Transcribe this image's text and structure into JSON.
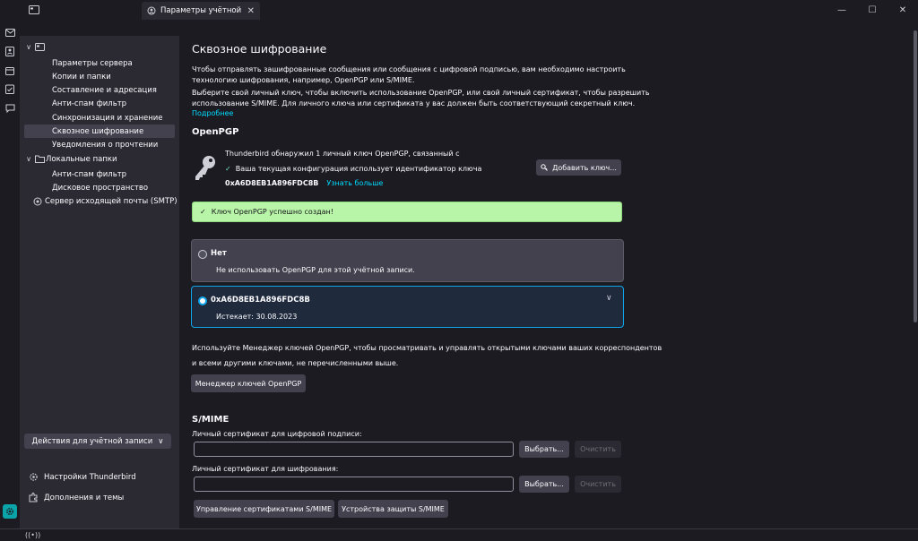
{
  "window": {
    "tab_title": "Параметры учётной записи",
    "minimize": "—",
    "maximize": "☐",
    "close": "✕"
  },
  "sidebar": {
    "account_row_label": "",
    "items": [
      {
        "label": "Параметры сервера"
      },
      {
        "label": "Копии и папки"
      },
      {
        "label": "Составление и адресация"
      },
      {
        "label": "Анти-спам фильтр"
      },
      {
        "label": "Синхронизация и хранение"
      },
      {
        "label": "Сквозное шифрование"
      },
      {
        "label": "Уведомления о прочтении"
      }
    ],
    "local_folders": "Локальные папки",
    "local_items": [
      {
        "label": "Анти-спам фильтр"
      },
      {
        "label": "Дисковое пространство"
      }
    ],
    "smtp": "Сервер исходящей почты (SMTP)",
    "account_actions": "Действия для учётной записи",
    "settings_link": "Настройки Thunderbird",
    "addons_link": "Дополнения и темы"
  },
  "main": {
    "title": "Сквозное шифрование",
    "intro1": "Чтобы отправлять зашифрованные сообщения или сообщения с цифровой подписью, вам необходимо настроить",
    "intro2": "технологию шифрования, например, OpenPGP или S/MIME.",
    "intro3": "Выберите свой личный ключ, чтобы включить использование OpenPGP, или свой личный сертификат, чтобы разрешить",
    "intro4": "использование S/MIME. Для личного ключа или сертификата у вас должен быть соответствующий секретный ключ.",
    "more_link": "Подробнее",
    "openpgp": {
      "heading": "OpenPGP",
      "found_text": "Thunderbird обнаружил 1 личный ключ OpenPGP, связанный с",
      "config_text": "Ваша текущая конфигурация использует идентификатор ключа",
      "key_id": "0xA6D8EB1A896FDC8B",
      "learn_more": "Узнать больше",
      "add_key_button": "Добавить ключ...",
      "success_message": "Ключ OpenPGP успешно создан!",
      "option_none_title": "Нет",
      "option_none_desc": "Не использовать OpenPGP для этой учётной записи.",
      "option_key_title": "0xA6D8EB1A896FDC8B",
      "option_key_expires": "Истекает: 30.08.2023",
      "manager_text1": "Используйте Менеджер ключей OpenPGP, чтобы просматривать и управлять открытыми ключами ваших корреспондентов",
      "manager_text2": "и всеми другими ключами, не перечисленными выше.",
      "manager_button": "Менеджер ключей OpenPGP"
    },
    "smime": {
      "heading": "S/MIME",
      "sign_label": "Личный сертификат для цифровой подписи:",
      "sign_value": "",
      "encrypt_label": "Личный сертификат для шифрования:",
      "encrypt_value": "",
      "select_button": "Выбрать...",
      "clear_button": "Очистить",
      "manage_certs_button": "Управление сертификатами S/MIME",
      "security_devices_button": "Устройства защиты S/MIME"
    }
  },
  "colors": {
    "accent": "#0ea5e9",
    "success_bg": "#b8f5a8",
    "sidebar_bg": "#2b2a33",
    "main_bg": "#1c1b22"
  }
}
